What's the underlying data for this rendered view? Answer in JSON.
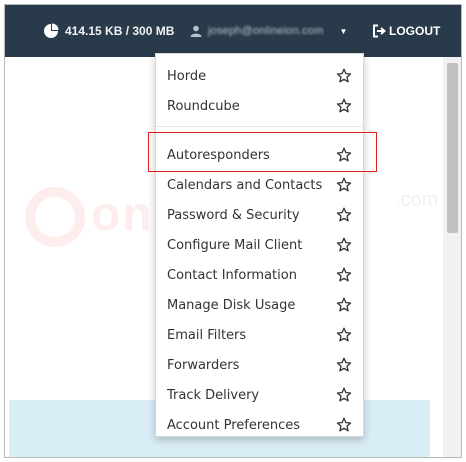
{
  "header": {
    "disk_usage": "414.15 KB / 300 MB",
    "user_email": "joseph@onlineion.com",
    "logout_label": "LOGOUT"
  },
  "watermark": {
    "text": "onlineion",
    "suffix": ".com"
  },
  "menu": {
    "items": [
      {
        "label": "Horde"
      },
      {
        "label": "Roundcube"
      },
      {
        "label": "Autoresponders"
      },
      {
        "label": "Calendars and Contacts"
      },
      {
        "label": "Password & Security"
      },
      {
        "label": "Configure Mail Client"
      },
      {
        "label": "Contact Information"
      },
      {
        "label": "Manage Disk Usage"
      },
      {
        "label": "Email Filters"
      },
      {
        "label": "Forwarders"
      },
      {
        "label": "Track Delivery"
      },
      {
        "label": "Account Preferences"
      }
    ]
  },
  "colors": {
    "topbar": "#293a4a",
    "highlight_box": "#e02020",
    "panel": "#d9edf7"
  },
  "icons": {
    "disk": "pie-chart-icon",
    "user": "user-icon",
    "dropdown": "caret-down-icon",
    "logout": "sign-out-icon",
    "favorite": "star-outline-icon"
  }
}
